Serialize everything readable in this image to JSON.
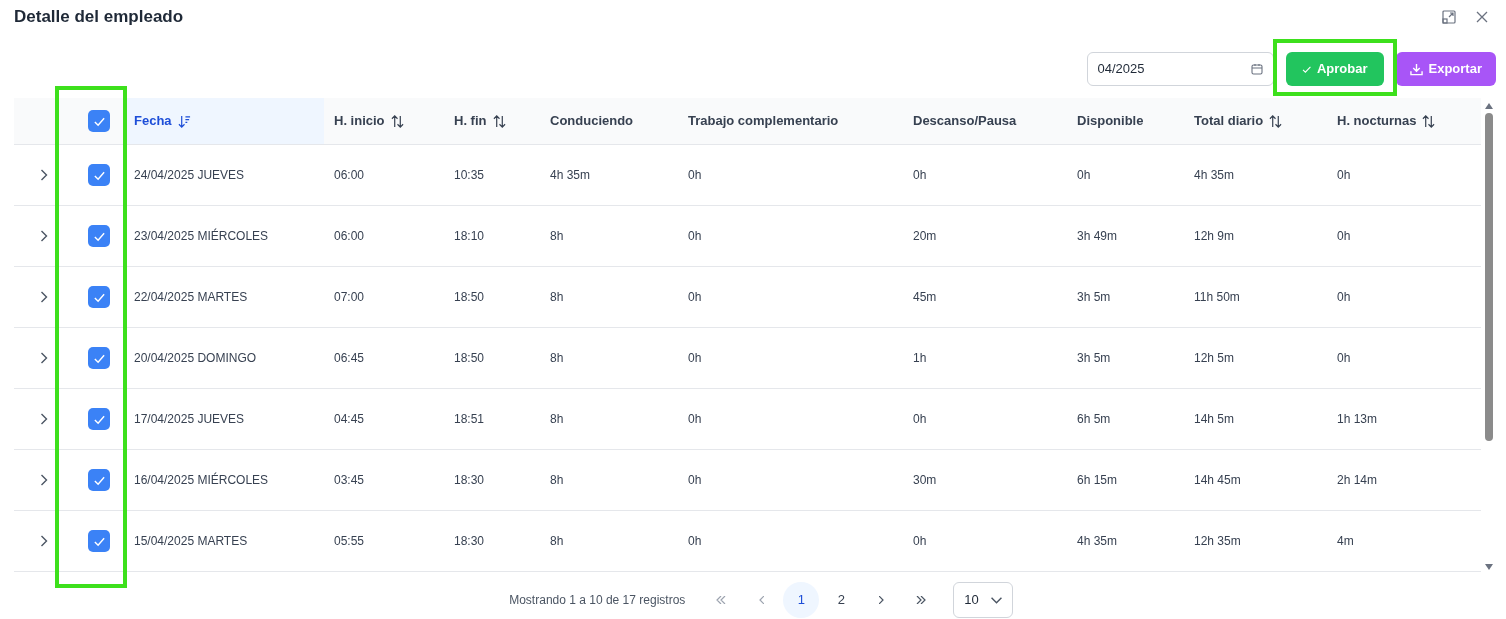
{
  "dialog": {
    "title": "Detalle del empleado"
  },
  "toolbar": {
    "month_field": {
      "value": "04/2025"
    },
    "approve_button": {
      "label": "Aprobar"
    },
    "export_button": {
      "label": "Exportar"
    }
  },
  "table": {
    "select_all": {
      "checked": true
    },
    "columns": [
      {
        "label": "Fecha",
        "sortable": true,
        "sorted": true
      },
      {
        "label": "H. inicio",
        "sortable": true,
        "sorted": false
      },
      {
        "label": "H. fin",
        "sortable": true,
        "sorted": false
      },
      {
        "label": "Conduciendo"
      },
      {
        "label": "Trabajo complementario"
      },
      {
        "label": "Descanso/Pausa"
      },
      {
        "label": "Disponible"
      },
      {
        "label": "Total diario",
        "sortable": true,
        "sorted": false
      },
      {
        "label": "H. nocturnas",
        "sortable": true,
        "sorted": false
      }
    ],
    "rows": [
      {
        "expanded": false,
        "checked": true,
        "cells": [
          "24/04/2025 JUEVES",
          "06:00",
          "10:35",
          "4h 35m",
          "0h",
          "0h",
          "0h",
          "4h 35m",
          "0h"
        ]
      },
      {
        "expanded": false,
        "checked": true,
        "cells": [
          "23/04/2025 MIÉRCOLES",
          "06:00",
          "18:10",
          "8h",
          "0h",
          "20m",
          "3h 49m",
          "12h 9m",
          "0h"
        ]
      },
      {
        "expanded": false,
        "checked": true,
        "cells": [
          "22/04/2025 MARTES",
          "07:00",
          "18:50",
          "8h",
          "0h",
          "45m",
          "3h 5m",
          "11h 50m",
          "0h"
        ]
      },
      {
        "expanded": false,
        "checked": true,
        "cells": [
          "20/04/2025 DOMINGO",
          "06:45",
          "18:50",
          "8h",
          "0h",
          "1h",
          "3h 5m",
          "12h 5m",
          "0h"
        ]
      },
      {
        "expanded": false,
        "checked": true,
        "cells": [
          "17/04/2025 JUEVES",
          "04:45",
          "18:51",
          "8h",
          "0h",
          "0h",
          "6h 5m",
          "14h 5m",
          "1h 13m"
        ]
      },
      {
        "expanded": false,
        "checked": true,
        "cells": [
          "16/04/2025 MIÉRCOLES",
          "03:45",
          "18:30",
          "8h",
          "0h",
          "30m",
          "6h 15m",
          "14h 45m",
          "2h 14m"
        ]
      },
      {
        "expanded": false,
        "checked": true,
        "cells": [
          "15/04/2025 MARTES",
          "05:55",
          "18:30",
          "8h",
          "0h",
          "0h",
          "4h 35m",
          "12h 35m",
          "4m"
        ]
      }
    ]
  },
  "pagination": {
    "summary": "Mostrando 1 a 10 de 17 registros",
    "pages": [
      {
        "label": "1",
        "selected": true
      },
      {
        "label": "2",
        "selected": false
      }
    ],
    "page_size": "10"
  },
  "highlights": {
    "select_column": true,
    "approve_button": true
  }
}
